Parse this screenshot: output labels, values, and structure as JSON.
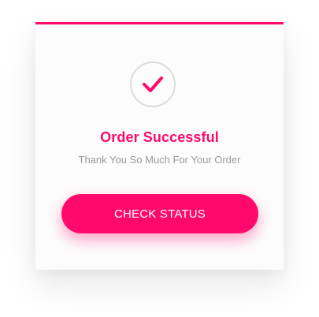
{
  "colors": {
    "accent": "#ff0a6c",
    "circle_border": "#dcdcdc",
    "subtitle_text": "#9a9a9a",
    "button_text": "#ffffff"
  },
  "icons": {
    "status": "checkmark-icon"
  },
  "card": {
    "title": "Order Successful",
    "subtitle": "Thank You So Much For Your Order",
    "button_label": "CHECK STATUS"
  }
}
